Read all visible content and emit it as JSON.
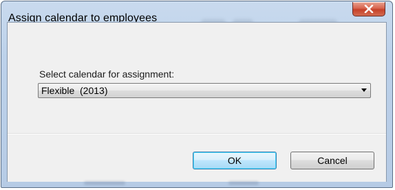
{
  "dialog": {
    "title": "Assign calendar to employees",
    "close_icon": "close-x-icon"
  },
  "form": {
    "label": "Select calendar for assignment:",
    "calendar_select": {
      "selected": "Flexible  (2013)",
      "arrow_icon": "chevron-down-icon"
    }
  },
  "buttons": {
    "ok_label": "OK",
    "cancel_label": "Cancel"
  },
  "colors": {
    "glass_frame": "#bcd1ea",
    "close_button": "#c6412a",
    "dialog_background": "#f0f0f0",
    "default_button_border": "#3c7fb1"
  }
}
